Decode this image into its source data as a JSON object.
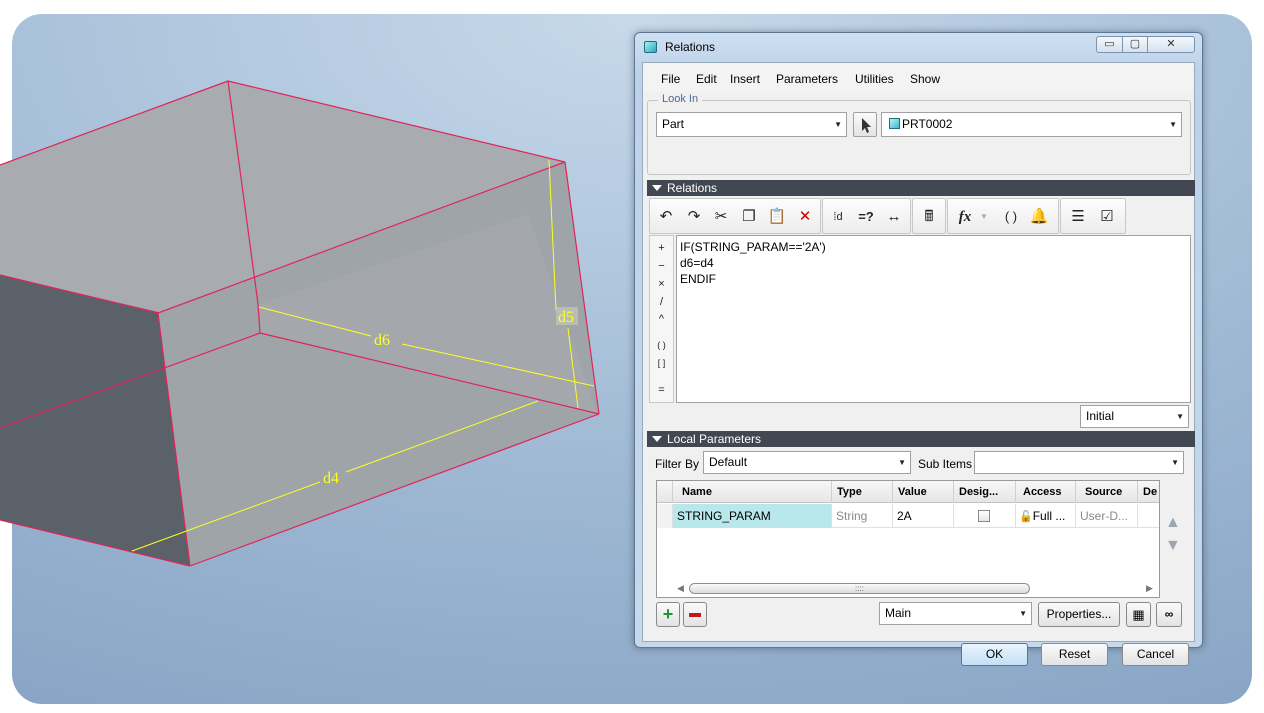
{
  "viewport": {
    "dim_labels": [
      "d6",
      "d5",
      "d4"
    ]
  },
  "dialog": {
    "title": "Relations",
    "window_buttons": {
      "minimize": "▭",
      "maximize": "▢",
      "close": "✕"
    },
    "menu": [
      "File",
      "Edit",
      "Insert",
      "Parameters",
      "Utilities",
      "Show"
    ],
    "look_in": {
      "label": "Look In",
      "type_value": "Part",
      "model_value": "PRT0002"
    },
    "relations_section": {
      "label": "Relations",
      "toolbar_icons": [
        "undo-icon",
        "redo-icon",
        "cut-icon",
        "copy-icon",
        "paste-icon",
        "delete-icon",
        "show-dimension-icon",
        "evaluate-icon",
        "unit-icon",
        "verify-icon",
        "function-icon",
        "parentheses-icon",
        "sort-icon",
        "sort-relations-icon",
        "verify-relations-icon"
      ],
      "function_symbol": "fx",
      "eval_symbol": "=?",
      "paren_symbol": "( )",
      "operators": [
        "+",
        "−",
        "×",
        "/",
        "^",
        "( )",
        "[ ]",
        "="
      ],
      "lines": [
        "IF(STRING_PARAM=='2A')",
        "d6=d4",
        "ENDIF"
      ],
      "mode_value": "Initial"
    },
    "local_parameters": {
      "label": "Local Parameters",
      "filter_label": "Filter By",
      "filter_value": "Default",
      "sub_items_label": "Sub Items",
      "sub_items_value": "",
      "columns": [
        "Name",
        "Type",
        "Value",
        "Desig...",
        "Access",
        "Source",
        "De"
      ],
      "rows": [
        {
          "name": "STRING_PARAM",
          "type": "String",
          "value": "2A",
          "designated": false,
          "access": "Full ...",
          "source": "User-D..."
        }
      ],
      "scroll_grip": "::::",
      "view_value": "Main",
      "properties_label": "Properties..."
    },
    "buttons": {
      "ok": "OK",
      "reset": "Reset",
      "cancel": "Cancel"
    },
    "colors": {
      "section_bar": "#414852",
      "selected_cell": "#b9e8ec",
      "edge": "#e0245a",
      "dimension": "#ffff1e"
    }
  }
}
